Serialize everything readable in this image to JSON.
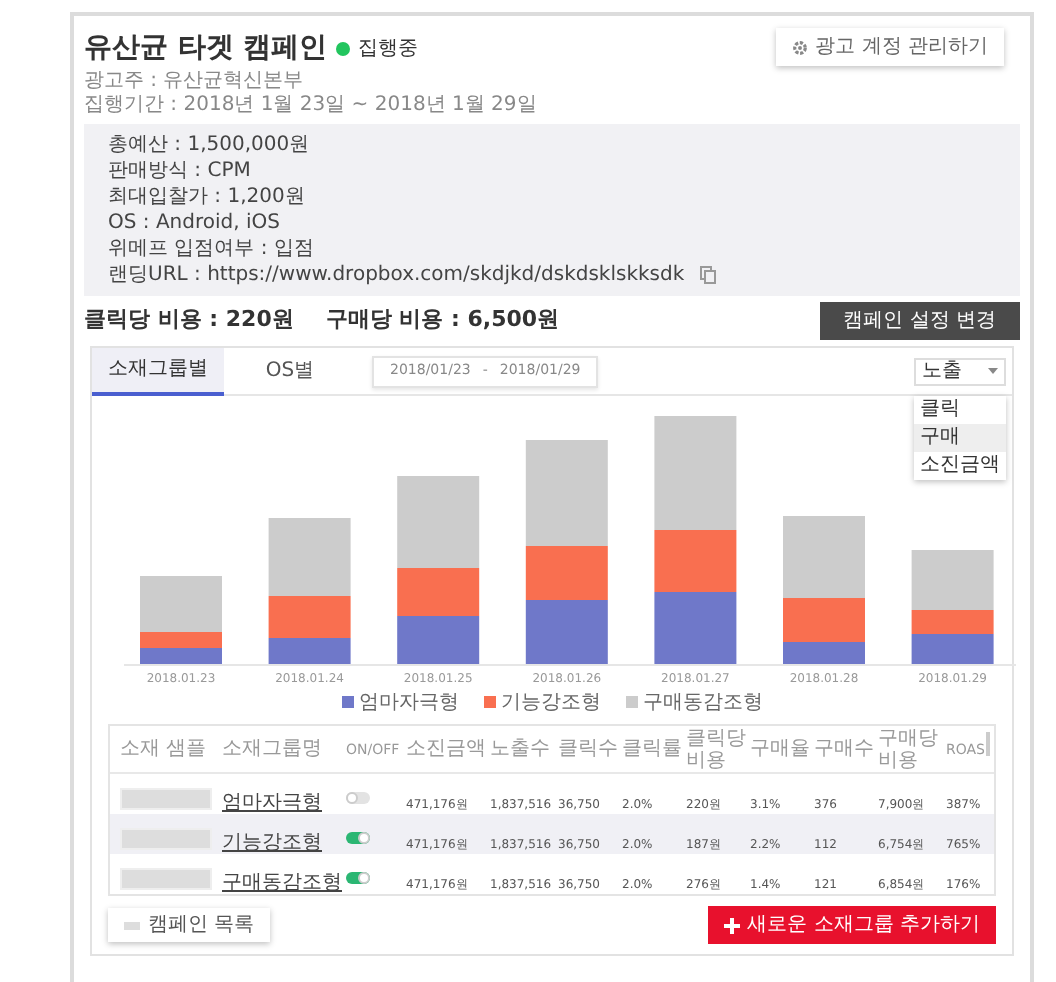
{
  "header": {
    "title": "유산균 타겟 캠페인",
    "status": {
      "label": "집행중",
      "color": "#22c55e"
    },
    "account_button": "광고 계정 관리하기",
    "advertiser": "광고주 : 유산균혁신본부",
    "period": "집행기간 : 2018년 1월 23일 ~ 2018년 1월 29일"
  },
  "info": [
    "총예산 : 1,500,000원",
    "판매방식 : CPM",
    "최대입찰가 : 1,200원",
    "OS : Android, iOS",
    "위메프 입점여부 : 입점"
  ],
  "landing_url": "랜딩URL : https://www.dropbox.com/skdjkd/dskdsklskksdk",
  "costs": [
    "클릭당 비용 : 220원",
    "구매당 비용 : 6,500원"
  ],
  "settings_button": "캠페인 설정 변경",
  "tabs": [
    {
      "label": "소재그룹별",
      "selected": true
    },
    {
      "label": "OS별",
      "selected": false
    }
  ],
  "date_range": {
    "start": "2018/01/23",
    "separator": "-",
    "end": "2018/01/29"
  },
  "metric_select": {
    "value": "노출",
    "options": [
      {
        "label": "클릭",
        "selected": false
      },
      {
        "label": "구매",
        "selected": true
      },
      {
        "label": "소진금액",
        "selected": false
      }
    ]
  },
  "chart": {
    "categories": [
      "2018.01.23",
      "2018.01.24",
      "2018.01.25",
      "2018.01.26",
      "2018.01.27",
      "2018.01.28",
      "2018.01.29"
    ],
    "legend": [
      {
        "label": "엄마자극형",
        "color": "#6f78c9"
      },
      {
        "label": "기능강조형",
        "color": "#f96f50"
      },
      {
        "label": "구매동감조형",
        "color": "#cccccc"
      }
    ]
  },
  "table": {
    "columns": [
      "소재 샘플",
      "소재그룹명",
      "ON/OFF",
      "소진금액",
      "노출수",
      "클릭수",
      "클릭률",
      "클릭당 비용",
      "구매율",
      "구매수",
      "구매당 비용",
      "ROAS"
    ],
    "rows": [
      {
        "selected": false,
        "on": false,
        "cells": [
          "",
          "엄마자극형",
          "",
          "471,176원",
          "1,837,516",
          "36,750",
          "2.0%",
          "220원",
          "3.1%",
          "376",
          "7,900원",
          "387%"
        ]
      },
      {
        "selected": true,
        "on": true,
        "cells": [
          "",
          "기능강조형",
          "",
          "471,176원",
          "1,837,516",
          "36,750",
          "2.0%",
          "187원",
          "2.2%",
          "112",
          "6,754원",
          "765%"
        ]
      },
      {
        "selected": false,
        "on": true,
        "cells": [
          "",
          "구매동감조형",
          "",
          "471,176원",
          "1,837,516",
          "36,750",
          "2.0%",
          "276원",
          "1.4%",
          "121",
          "6,854원",
          "176%"
        ]
      }
    ]
  },
  "list_button": "캠페인 목록",
  "add_button": "새로운 소재그룹 추가하기"
}
